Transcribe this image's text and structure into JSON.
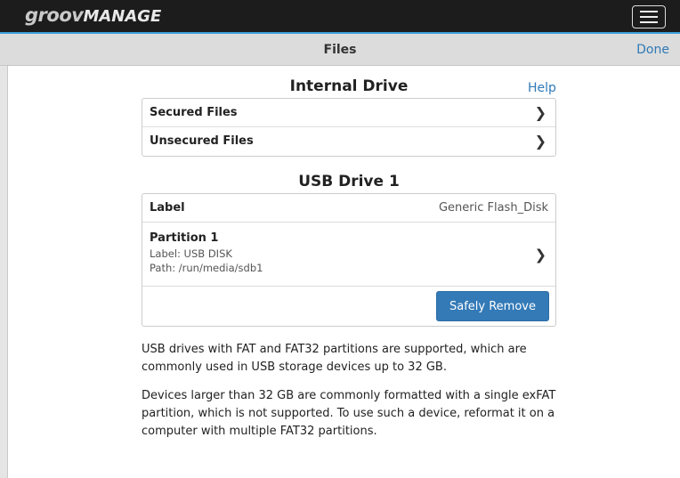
{
  "header": {
    "logo_groov": "groov",
    "logo_manage": "MANAGE",
    "menu_icon": "hamburger-menu-icon"
  },
  "subbar": {
    "title": "Files",
    "done_label": "Done"
  },
  "internal": {
    "title": "Internal Drive",
    "help_label": "Help",
    "items": [
      {
        "label": "Secured Files",
        "icon": "chevron-right-icon"
      },
      {
        "label": "Unsecured Files",
        "icon": "chevron-right-icon"
      }
    ]
  },
  "usb": {
    "title": "USB Drive 1",
    "label_name": "Label",
    "label_value": "Generic Flash_Disk",
    "partition": {
      "title": "Partition 1",
      "label_line": "Label: USB DISK",
      "path_line": "Path: /run/media/sdb1"
    },
    "remove_label": "Safely Remove"
  },
  "info": {
    "paragraph1": "USB drives with FAT and FAT32 partitions are supported, which are commonly used in USB storage devices up to 32 GB.",
    "paragraph2": "Devices larger than 32 GB are commonly formatted with a single exFAT partition, which is not supported. To use such a device, reformat it on a computer with multiple FAT32 partitions."
  }
}
